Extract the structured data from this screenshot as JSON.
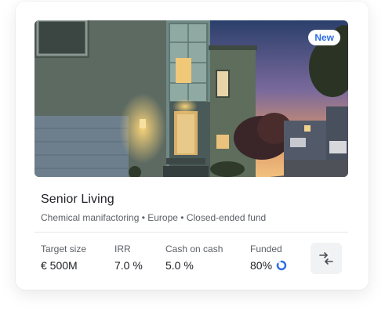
{
  "card": {
    "badge": "New",
    "title": "Senior Living",
    "subtitle": "Chemical manifactoring • Europe • Closed-ended fund",
    "stats": [
      {
        "label": "Target size",
        "value": "€ 500M"
      },
      {
        "label": "IRR",
        "value": "7.0 %"
      },
      {
        "label": "Cash on cash",
        "value": "5.0 %"
      },
      {
        "label": "Funded",
        "value": "80%",
        "progress": 0.8
      }
    ],
    "icons": {
      "compare": "compare-arrows-icon",
      "funded": "progress-ring-icon"
    },
    "colors": {
      "accent": "#2f6fe4",
      "text": "#1d1f24",
      "muted": "#5b5f66"
    }
  }
}
